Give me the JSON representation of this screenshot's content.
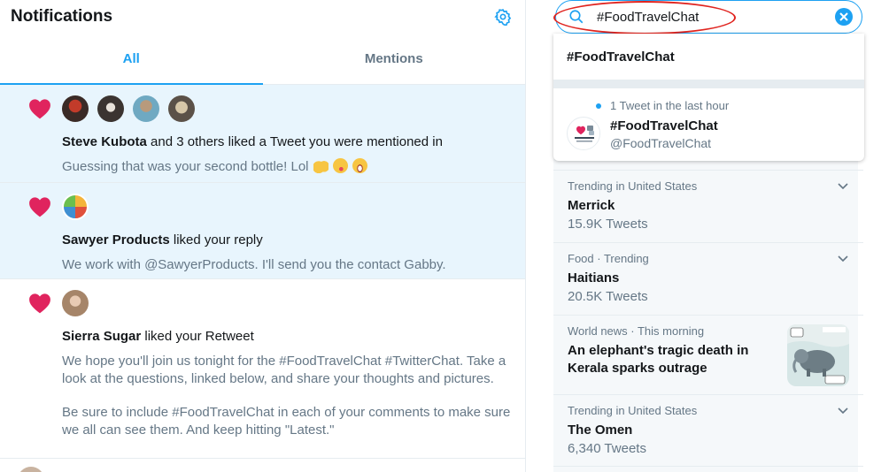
{
  "header": {
    "title": "Notifications"
  },
  "tabs": [
    {
      "label": "All"
    },
    {
      "label": "Mentions"
    }
  ],
  "notifications": [
    {
      "name": "Steve Kubota",
      "action": " and 3 others liked a Tweet you were mentioned in",
      "text": "Guessing that was your second bottle!  Lol"
    },
    {
      "name": "Sawyer Products",
      "action": " liked your reply",
      "text": "We work with @SawyerProducts. I'll send you the contact Gabby."
    },
    {
      "name": "Sierra Sugar",
      "action": " liked your Retweet",
      "text": "We hope you'll join us tonight for the #FoodTravelChat #TwitterChat. Take a look at the questions, linked below, and share your thoughts and pictures.",
      "text2": "Be sure to include #FoodTravelChat in each of your comments to make sure we all can see them. And keep hitting \"Latest.\""
    }
  ],
  "search": {
    "value": "#FoodTravelChat"
  },
  "dropdown": {
    "query": "#FoodTravelChat",
    "activity": "1 Tweet in the last hour",
    "name": "#FoodTravelChat",
    "handle": "@FoodTravelChat"
  },
  "trends": [
    {
      "context": "Trending in United States",
      "title": "Merrick",
      "count": "15.9K Tweets"
    },
    {
      "context": "Food · Trending",
      "title": "Haitians",
      "count": "20.5K Tweets"
    },
    {
      "context": "World news · This morning",
      "title": "An elephant's tragic death in Kerala sparks outrage"
    },
    {
      "context": "Trending in United States",
      "title": "The Omen",
      "count": "6,340 Tweets"
    }
  ],
  "colors": {
    "accent": "#1da1f2",
    "like": "#e0245e",
    "highlight": "#e8f5fd",
    "annotation": "#e0241f"
  },
  "icons": [
    "gear-icon",
    "heart-icon",
    "search-icon",
    "close-icon",
    "chevron-down-icon"
  ]
}
